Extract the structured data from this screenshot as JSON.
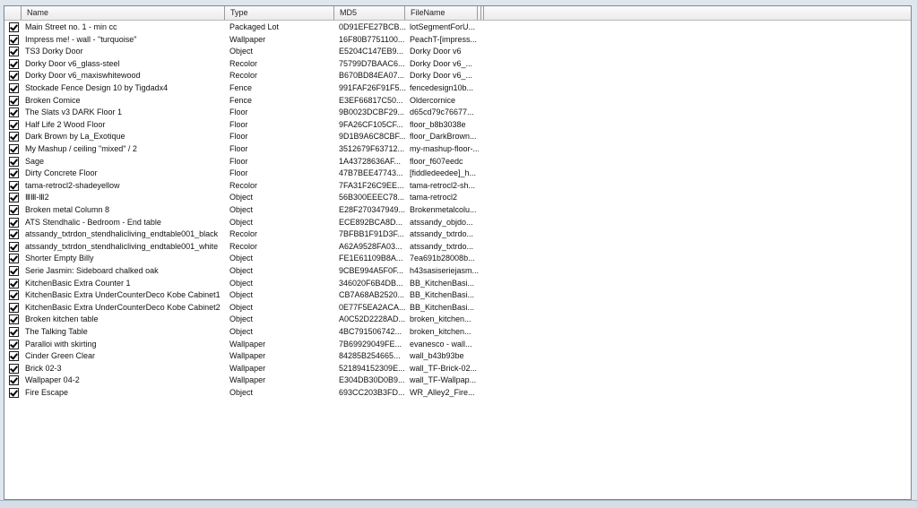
{
  "columns": {
    "name": "Name",
    "type": "Type",
    "md5": "MD5",
    "filename": "FileName"
  },
  "rows": [
    {
      "checked": true,
      "name": "Main Street no. 1 - min cc",
      "type": "Packaged Lot",
      "md5": "0D91EFE27BCB...",
      "file": "lotSegmentForU..."
    },
    {
      "checked": true,
      "name": "Impress me! - wall - \"turquoise\"",
      "type": "Wallpaper",
      "md5": "16F80B7751100...",
      "file": "PeachT-[impress..."
    },
    {
      "checked": true,
      "name": "TS3 Dorky Door",
      "type": "Object",
      "md5": "E5204C147EB9...",
      "file": "Dorky Door v6"
    },
    {
      "checked": true,
      "name": "Dorky Door v6_glass-steel",
      "type": "Recolor",
      "md5": "75799D7BAAC6...",
      "file": "Dorky Door v6_..."
    },
    {
      "checked": true,
      "name": "Dorky Door v6_maxiswhitewood",
      "type": "Recolor",
      "md5": "B670BD84EA07...",
      "file": "Dorky Door v6_..."
    },
    {
      "checked": true,
      "name": "Stockade Fence Design 10 by Tigdadx4",
      "type": "Fence",
      "md5": "991FAF26F91F5...",
      "file": "fencedesign10b..."
    },
    {
      "checked": true,
      "name": "Broken Comice",
      "type": "Fence",
      "md5": "E3EF66817C50...",
      "file": "Oldercornice"
    },
    {
      "checked": true,
      "name": "The Slats v3 DARK Floor 1",
      "type": "Floor",
      "md5": "9B0023DCBF29...",
      "file": "d65cd79c76677..."
    },
    {
      "checked": true,
      "name": "Half Life 2 Wood Floor",
      "type": "Floor",
      "md5": "9FA26CF105CF...",
      "file": "floor_b8b3038e"
    },
    {
      "checked": true,
      "name": "Dark Brown by La_Exotique",
      "type": "Floor",
      "md5": "9D1B9A6C8CBF...",
      "file": "floor_DarkBrown..."
    },
    {
      "checked": true,
      "name": "My Mashup / ceiling \"mixed\" / 2",
      "type": "Floor",
      "md5": "3512679F63712...",
      "file": "my-mashup-floor-..."
    },
    {
      "checked": true,
      "name": "Sage",
      "type": "Floor",
      "md5": "1A43728636AF...",
      "file": "floor_f607eedc"
    },
    {
      "checked": true,
      "name": "Dirty Concrete Floor",
      "type": "Floor",
      "md5": "47B7BEE47743...",
      "file": "[fiddledeedee]_h..."
    },
    {
      "checked": true,
      "name": "tama-retrocl2-shadeyellow",
      "type": "Recolor",
      "md5": "7FA31F26C9EE...",
      "file": "tama-retrocl2-sh..."
    },
    {
      "checked": true,
      "name": "ⅢⅢ-Ⅲ2",
      "type": "Object",
      "md5": "56B300EEEC78...",
      "file": "tama-retrocl2"
    },
    {
      "checked": true,
      "name": "Broken metal Column 8",
      "type": "Object",
      "md5": "E28F270347949...",
      "file": "Brokenmetalcolu..."
    },
    {
      "checked": true,
      "name": "ATS Stendhalic - Bedroom - End table",
      "type": "Object",
      "md5": "ECE892BCA8D...",
      "file": "atssandy_objdo..."
    },
    {
      "checked": true,
      "name": "atssandy_txtrdon_stendhalicliving_endtable001_black",
      "type": "Recolor",
      "md5": "7BFBB1F91D3F...",
      "file": "atssandy_txtrdo..."
    },
    {
      "checked": true,
      "name": "atssandy_txtrdon_stendhalicliving_endtable001_white",
      "type": "Recolor",
      "md5": "A62A9528FA03...",
      "file": "atssandy_txtrdo..."
    },
    {
      "checked": true,
      "name": "Shorter Empty Billy",
      "type": "Object",
      "md5": "FE1E61109B8A...",
      "file": "7ea691b28008b..."
    },
    {
      "checked": true,
      "name": "Serie Jasmin: Sideboard chalked oak",
      "type": "Object",
      "md5": "9CBE994A5F0F...",
      "file": "h43sasiseriejasm..."
    },
    {
      "checked": true,
      "name": "KitchenBasic Extra Counter 1",
      "type": "Object",
      "md5": "346020F6B4DB...",
      "file": "BB_KitchenBasi..."
    },
    {
      "checked": true,
      "name": "KitchenBasic Extra UnderCounterDeco Kobe Cabinet1",
      "type": "Object",
      "md5": "CB7A68AB2520...",
      "file": "BB_KitchenBasi..."
    },
    {
      "checked": true,
      "name": "KitchenBasic Extra UnderCounterDeco Kobe Cabinet2",
      "type": "Object",
      "md5": "0E77F5EA2ACA...",
      "file": "BB_KitchenBasi..."
    },
    {
      "checked": true,
      "name": "Broken kitchen table",
      "type": "Object",
      "md5": "A0C52D2228AD...",
      "file": "broken_kitchen..."
    },
    {
      "checked": true,
      "name": "The Talking Table",
      "type": "Object",
      "md5": "4BC791506742...",
      "file": "broken_kitchen..."
    },
    {
      "checked": true,
      "name": "Paralloi with skirting",
      "type": "Wallpaper",
      "md5": "7B69929049FE...",
      "file": "evanesco - wall..."
    },
    {
      "checked": true,
      "name": "Cinder Green Clear",
      "type": "Wallpaper",
      "md5": "84285B254665...",
      "file": "wall_b43b93be"
    },
    {
      "checked": true,
      "name": "Brick 02-3",
      "type": "Wallpaper",
      "md5": "521894152309E...",
      "file": "wall_TF-Brick-02..."
    },
    {
      "checked": true,
      "name": "Wallpaper 04-2",
      "type": "Wallpaper",
      "md5": "E304DB30D0B9...",
      "file": "wall_TF-Wallpap..."
    },
    {
      "checked": true,
      "name": "Fire Escape",
      "type": "Object",
      "md5": "693CC203B3FD...",
      "file": "WR_Alley2_Fire..."
    }
  ]
}
